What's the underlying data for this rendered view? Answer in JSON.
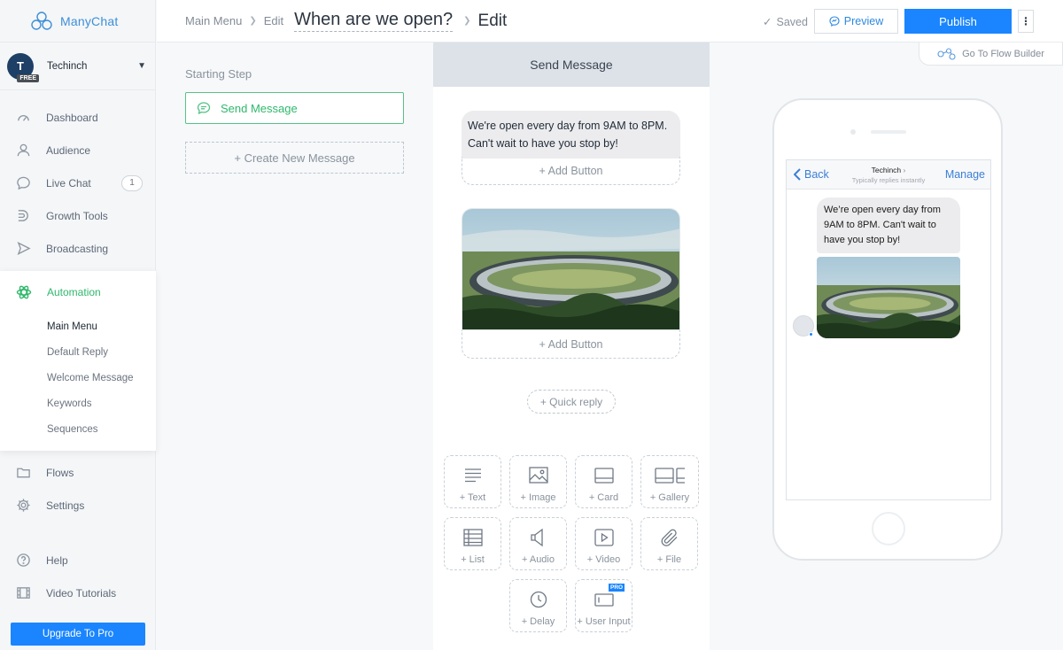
{
  "brand": {
    "name": "ManyChat"
  },
  "account": {
    "initials": "T",
    "plan": "FREE",
    "name": "Techinch"
  },
  "nav": {
    "dashboard": "Dashboard",
    "audience": "Audience",
    "live_chat": "Live Chat",
    "live_chat_count": "1",
    "growth_tools": "Growth Tools",
    "broadcasting": "Broadcasting",
    "automation": "Automation",
    "automation_sub": [
      "Main Menu",
      "Default Reply",
      "Welcome Message",
      "Keywords",
      "Sequences"
    ],
    "flows": "Flows",
    "settings": "Settings",
    "help": "Help",
    "video_tutorials": "Video Tutorials",
    "upgrade": "Upgrade To Pro"
  },
  "topbar": {
    "crumb1": "Main Menu",
    "crumb2": "Edit",
    "title": "When are we open?",
    "edit": "Edit",
    "saved": "Saved",
    "preview": "Preview",
    "publish": "Publish",
    "more": "⋮"
  },
  "flow_builder": "Go To Flow Builder",
  "steps": {
    "starting_label": "Starting Step",
    "step_name": "Send Message",
    "new_message": "+ Create New Message"
  },
  "editor": {
    "header": "Send Message",
    "text_message": "We're open every day from 9AM to 8PM. Can't wait to have you stop by!",
    "add_button": "+ Add Button",
    "quick_reply": "+ Quick reply",
    "tiles": {
      "text": "+ Text",
      "image": "+ Image",
      "card": "+ Card",
      "gallery": "+ Gallery",
      "list": "+ List",
      "audio": "+ Audio",
      "video": "+ Video",
      "file": "+ File",
      "delay": "+ Delay",
      "user_input": "+ User Input",
      "pro": "PRO"
    }
  },
  "phone": {
    "back": "Back",
    "page_name": "Techinch",
    "page_sub": "Typically replies instantly",
    "manage": "Manage",
    "message": "We’re open every day from 9AM to 8PM. Can't wait to have you stop by!"
  },
  "colors": {
    "accent": "#1a85ff",
    "green": "#2fb86c"
  }
}
